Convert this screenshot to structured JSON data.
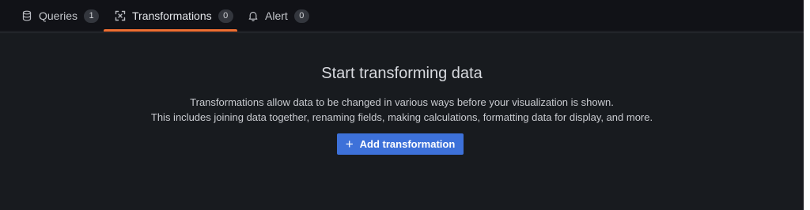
{
  "tabs": [
    {
      "label": "Queries",
      "count": "1",
      "icon": "database-icon",
      "active": false
    },
    {
      "label": "Transformations",
      "count": "0",
      "icon": "transform-icon",
      "active": true
    },
    {
      "label": "Alert",
      "count": "0",
      "icon": "bell-icon",
      "active": false
    }
  ],
  "empty_state": {
    "title": "Start transforming data",
    "description_line1": "Transformations allow data to be changed in various ways before your visualization is shown.",
    "description_line2": "This includes joining data together, renaming fields, making calculations, formatting data for display, and more.",
    "button_icon": "+",
    "button_label": "Add transformation"
  },
  "colors": {
    "background": "#111217",
    "panel": "#181b1f",
    "active_tab_underline": "#f06f32",
    "primary_button": "#3d71d9"
  }
}
